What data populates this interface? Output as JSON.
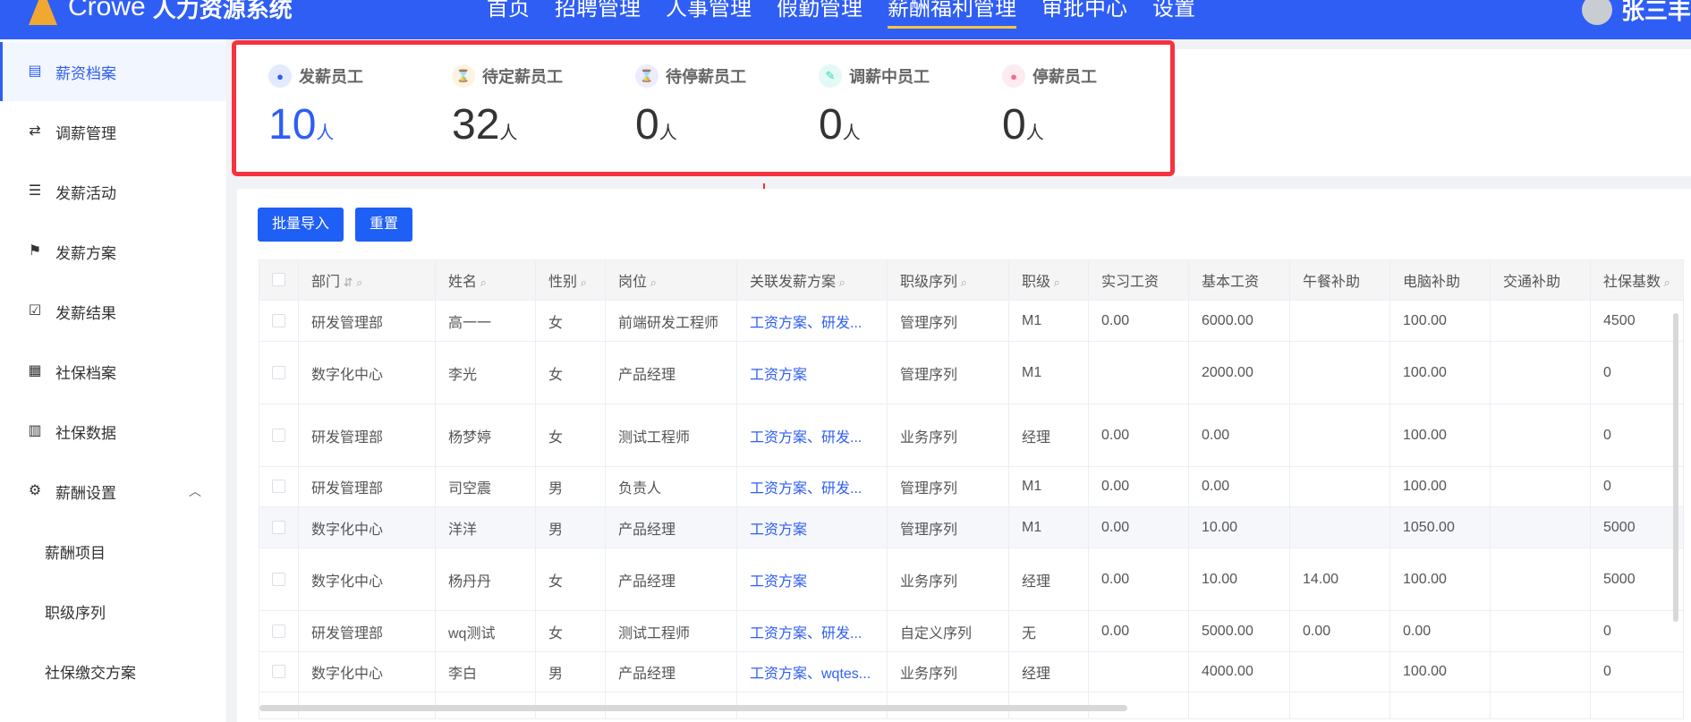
{
  "header": {
    "brand": "Crowe",
    "system": "人力资源系统",
    "nav": [
      "首页",
      "招聘管理",
      "人事管理",
      "假勤管理",
      "薪酬福利管理",
      "审批中心",
      "设置"
    ],
    "active_nav": "薪酬福利管理",
    "user": "张三丰"
  },
  "sidebar": {
    "items": [
      {
        "label": "薪资档案",
        "icon": "file-icon"
      },
      {
        "label": "调薪管理",
        "icon": "exchange-icon"
      },
      {
        "label": "发薪活动",
        "icon": "list-icon"
      },
      {
        "label": "发薪方案",
        "icon": "flag-icon"
      },
      {
        "label": "发薪结果",
        "icon": "clipboard-check-icon"
      },
      {
        "label": "社保档案",
        "icon": "grid-icon"
      },
      {
        "label": "社保数据",
        "icon": "bar-chart-icon"
      },
      {
        "label": "薪酬设置",
        "icon": "gear-icon"
      }
    ],
    "sub_items": [
      "薪酬项目",
      "职级序列",
      "社保缴交方案"
    ]
  },
  "stats": [
    {
      "label": "发薪员工",
      "value": "10",
      "unit": "人",
      "color": "#2f5ef5"
    },
    {
      "label": "待定薪员工",
      "value": "32",
      "unit": "人",
      "color": "#f5a623"
    },
    {
      "label": "待停薪员工",
      "value": "0",
      "unit": "人",
      "color": "#7b6cf6"
    },
    {
      "label": "调薪中员工",
      "value": "0",
      "unit": "人",
      "color": "#2fd4b5"
    },
    {
      "label": "停薪员工",
      "value": "0",
      "unit": "人",
      "color": "#f56c8a"
    }
  ],
  "toolbar": {
    "import": "批量导入",
    "reset": "重置"
  },
  "table": {
    "columns": [
      "部门",
      "姓名",
      "性别",
      "岗位",
      "关联发薪方案",
      "职级序列",
      "职级",
      "实习工资",
      "基本工资",
      "午餐补助",
      "电脑补助",
      "交通补助",
      "社保基数"
    ],
    "rows": [
      [
        "研发管理部",
        "高一一",
        "女",
        "前端研发工程师",
        "工资方案、研发...",
        "管理序列",
        "M1",
        "0.00",
        "6000.00",
        "",
        "100.00",
        "",
        "4500"
      ],
      [
        "数字化中心",
        "李光",
        "女",
        "产品经理",
        "工资方案",
        "管理序列",
        "M1",
        "",
        "2000.00",
        "",
        "100.00",
        "",
        "0"
      ],
      [
        "研发管理部",
        "杨梦婷",
        "女",
        "测试工程师",
        "工资方案、研发...",
        "业务序列",
        "经理",
        "0.00",
        "0.00",
        "",
        "100.00",
        "",
        "0"
      ],
      [
        "研发管理部",
        "司空震",
        "男",
        "负责人",
        "工资方案、研发...",
        "管理序列",
        "M1",
        "0.00",
        "0.00",
        "",
        "100.00",
        "",
        "0"
      ],
      [
        "数字化中心",
        "洋洋",
        "男",
        "产品经理",
        "工资方案",
        "管理序列",
        "M1",
        "0.00",
        "10.00",
        "",
        "1050.00",
        "",
        "5000"
      ],
      [
        "数字化中心",
        "杨丹丹",
        "女",
        "产品经理",
        "工资方案",
        "业务序列",
        "经理",
        "0.00",
        "10.00",
        "14.00",
        "100.00",
        "",
        "5000"
      ],
      [
        "研发管理部",
        "wq测试",
        "女",
        "测试工程师",
        "工资方案、研发...",
        "自定义序列",
        "无",
        "0.00",
        "5000.00",
        "0.00",
        "0.00",
        "",
        "0"
      ],
      [
        "数字化中心",
        "李白",
        "男",
        "产品经理",
        "工资方案、wqtes...",
        "业务序列",
        "经理",
        "",
        "4000.00",
        "",
        "100.00",
        "",
        "0"
      ]
    ]
  }
}
